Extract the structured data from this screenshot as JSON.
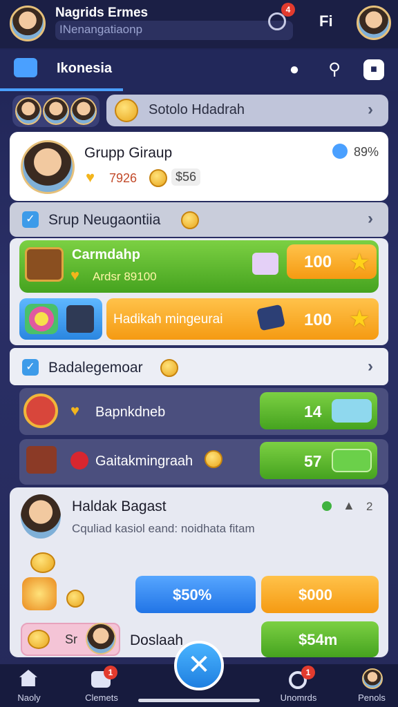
{
  "header": {
    "title": "Nagrids Ermes",
    "search_text": "INenangatiaonp",
    "notif_count": "4",
    "right_badge": "Fi"
  },
  "tabs": {
    "active_label": "Ikonesia"
  },
  "promo": {
    "label": "Sotolo Hdadrah"
  },
  "group_card": {
    "title": "Grupp Giraup",
    "percent": "89%",
    "hearts": "7926",
    "cash": "$56"
  },
  "section1": {
    "title": "Srup Neugaontiia"
  },
  "reward_rows": [
    {
      "title": "Carmdahp",
      "subtitle": "Ardsr 89100",
      "value": "100"
    },
    {
      "title": "Hadikah mingeurai",
      "value": "100"
    }
  ],
  "section2": {
    "title": "Badalegemoar"
  },
  "claim_rows": [
    {
      "title": "Bapnkdneb",
      "value": "14"
    },
    {
      "title": "Gaitakmingraah",
      "value": "57"
    }
  ],
  "profile_card": {
    "name": "Haldak Bagast",
    "description": "Cquliad kasiol eand: noidhata fitam",
    "stat": "2"
  },
  "buttons": {
    "blue": "$50%",
    "orange": "$000",
    "green": "$54m"
  },
  "bottom_row": {
    "tag": "Sr",
    "label": "Doslaah"
  },
  "bottom_nav": [
    {
      "label": "Naoly"
    },
    {
      "label": "Clemets",
      "badge": "1"
    },
    {
      "label": "Unomrds",
      "badge": "1"
    },
    {
      "label": "Penols"
    }
  ],
  "colors": {
    "accent": "#4aa0ff",
    "orange": "#f59a12",
    "green": "#45a31f",
    "blue": "#2174e6"
  }
}
